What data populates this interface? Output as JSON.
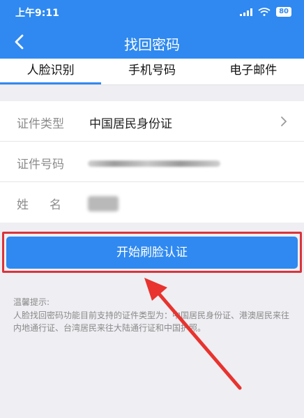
{
  "status": {
    "time": "上午9:11",
    "battery": "80"
  },
  "header": {
    "title": "找回密码"
  },
  "tabs": [
    {
      "label": "人脸识别"
    },
    {
      "label": "手机号码"
    },
    {
      "label": "电子邮件"
    }
  ],
  "form": {
    "id_type_label": "证件类型",
    "id_type_value": "中国居民身份证",
    "id_number_label": "证件号码",
    "name_label": "姓名"
  },
  "action": {
    "start_label": "开始刷脸认证"
  },
  "tip": {
    "title": "温馨提示:",
    "body": "人脸找回密码功能目前支持的证件类型为：中国居民身份证、港澳居民来往内地通行证、台湾居民来往大陆通行证和中国护照。"
  },
  "colors": {
    "primary": "#2f89f0",
    "highlight": "#d9343a",
    "background": "#eeeef3"
  }
}
